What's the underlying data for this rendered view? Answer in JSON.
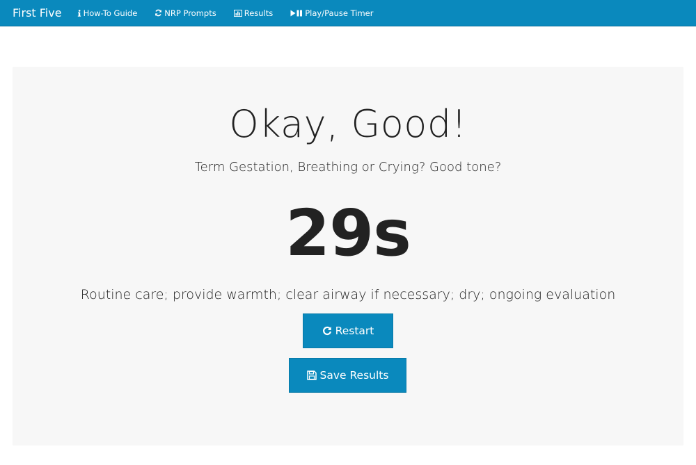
{
  "navbar": {
    "brand": "First Five",
    "items": [
      {
        "label": "How-To Guide",
        "icon": "info-icon"
      },
      {
        "label": "NRP Prompts",
        "icon": "refresh-icon"
      },
      {
        "label": "Results",
        "icon": "bar-chart-icon"
      },
      {
        "label": "Play/Pause Timer",
        "icon": "play-pause-icon"
      }
    ],
    "color": "#0a89bd"
  },
  "main": {
    "headline": "Okay, Good!",
    "question": "Term Gestation, Breathing or Crying? Good tone?",
    "timer": "29s",
    "instruction": "Routine care; provide warmth; clear airway if necessary; dry; ongoing evaluation",
    "buttons": {
      "restart_label": "Restart",
      "restart_icon": "restart-icon",
      "save_label": "Save Results",
      "save_icon": "save-icon"
    },
    "panel_background": "#f7f7f7"
  }
}
